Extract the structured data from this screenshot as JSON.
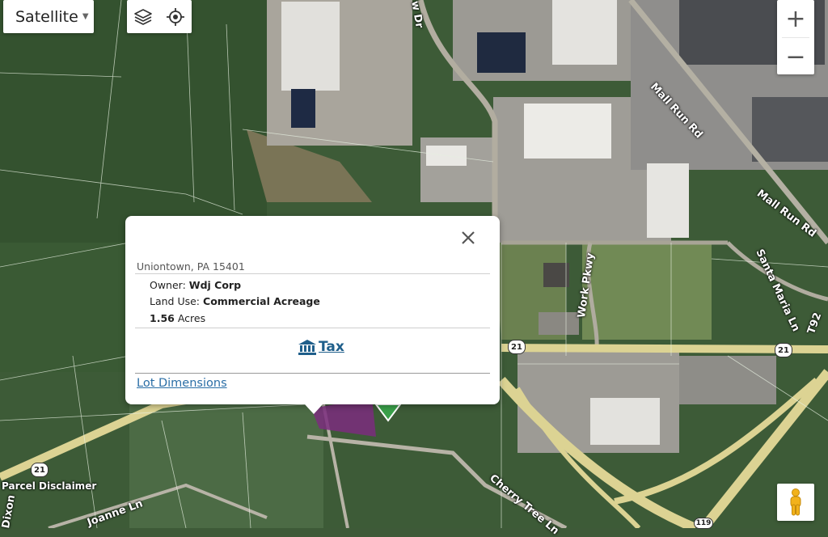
{
  "map_type": {
    "label": "Satellite"
  },
  "tools": {
    "layers_icon": "layers-icon",
    "locate_icon": "crosshair-icon"
  },
  "zoom": {
    "in_label": "+",
    "out_label": "−"
  },
  "popup": {
    "address": "Uniontown, PA 15401",
    "owner_label": "Owner:",
    "owner_value": "Wdj Corp",
    "land_use_label": "Land Use:",
    "land_use_value": "Commercial Acreage",
    "acres_value": "1.56",
    "acres_unit": "Acres",
    "tax_label": "Tax",
    "tax_icon": "bank-icon",
    "lot_dimensions_label": "Lot Dimensions",
    "close_icon": "close-icon"
  },
  "map_labels": {
    "mall_run_rd_1": "Mall Run Rd",
    "mall_run_rd_2": "Mall Run Rd",
    "santa_maria_ln": "Santa Maria Ln",
    "work_pkwy": "Work Pkwy",
    "cherry_tree_ln": "Cherry Tree Ln",
    "joanne_ln": "Joanne Ln",
    "dixon": "Dixon",
    "top_road": "w Dr",
    "parcel_disclaimer": "Parcel Disclaimer",
    "t92": "T92",
    "route_21_a": "21",
    "route_21_b": "21",
    "route_21_c": "21",
    "route_119": "119"
  },
  "colors": {
    "parcel_highlight": "#7b2d7e",
    "marker": "#3aa04a",
    "link": "#2a6ea6",
    "tax": "#1f5f8b"
  }
}
